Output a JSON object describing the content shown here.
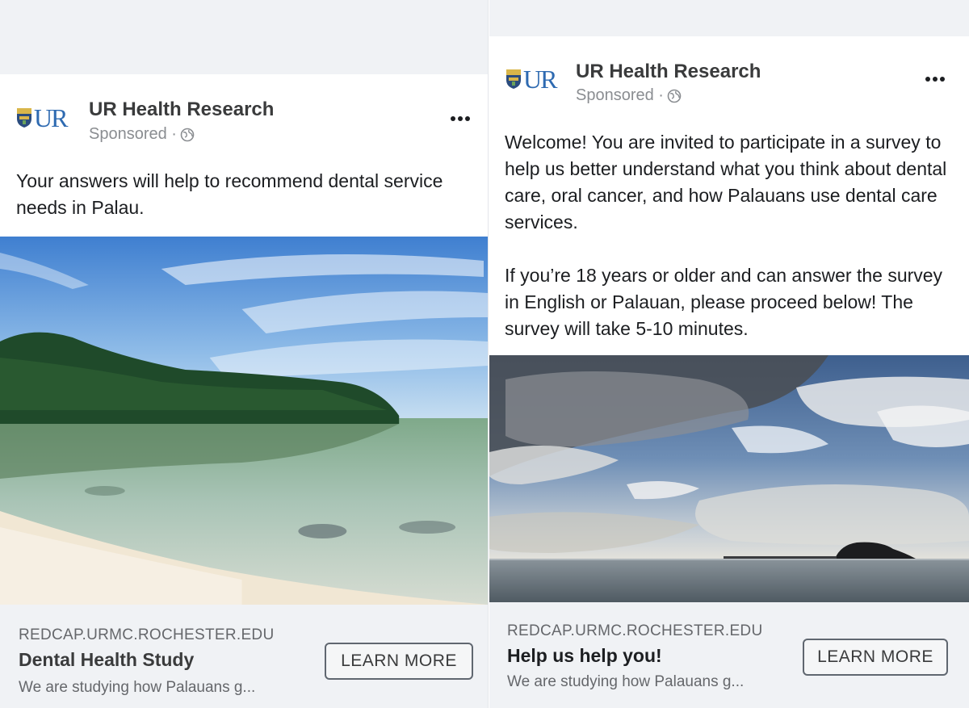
{
  "brand": {
    "logo_text": "UR",
    "logo_icon": "shield-icon",
    "accent_color": "#2e6ab1"
  },
  "ads": [
    {
      "page_name": "UR Health Research",
      "sponsored_label": "Sponsored ·",
      "audience_icon": "globe-icon",
      "more_icon": "more-options-icon",
      "body_text": "Your answers will help to recommend dental service needs in Palau.",
      "photo": "photo of a calm beach with a forested island and shallow clear water",
      "footer": {
        "domain": "REDCAP.URMC.ROCHESTER.EDU",
        "headline": "Dental Health Study",
        "description": "We are studying how Palauans g...",
        "cta_label": "LEARN MORE"
      }
    },
    {
      "page_name": "UR Health Research",
      "sponsored_label": "Sponsored ·",
      "audience_icon": "globe-icon",
      "more_icon": "more-options-icon",
      "body_text": "Welcome! You are invited to participate in a survey to help us better understand what you think about dental care, oral cancer, and how Palauans use dental care services.\n\nIf you’re 18 years or older and can answer the survey in English or Palauan, please proceed below! The survey will take 5-10 minutes.",
      "photo": "photo of a cloudy sky over the sea with a small dark island",
      "footer": {
        "domain": "REDCAP.URMC.ROCHESTER.EDU",
        "headline": "Help us help you!",
        "description": "We are studying how Palauans g...",
        "cta_label": "LEARN MORE"
      }
    }
  ]
}
